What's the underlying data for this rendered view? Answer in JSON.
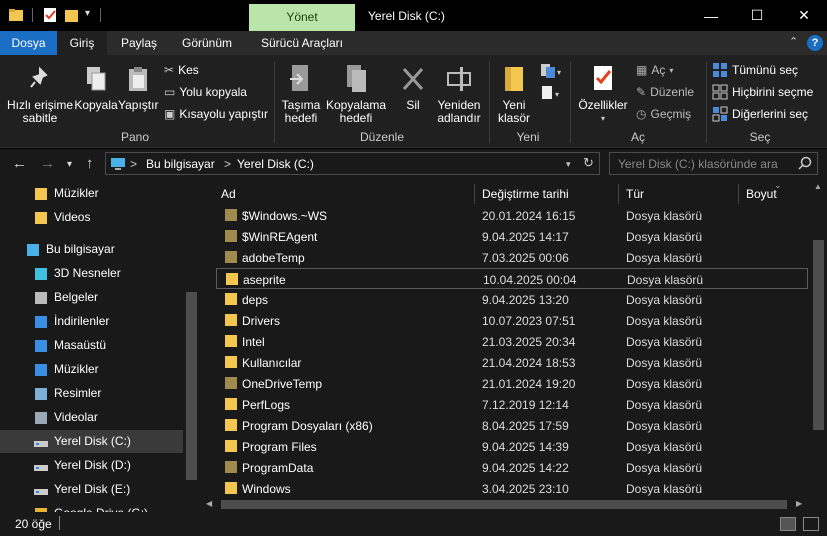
{
  "window": {
    "title": "Yerel Disk (C:)",
    "context_tab": "Yönet",
    "minimize": "—",
    "maximize": "☐",
    "close": "✕"
  },
  "ribbon_tabs": {
    "dosya": "Dosya",
    "giris": "Giriş",
    "paylas": "Paylaş",
    "gorunum": "Görünüm",
    "surucu": "Sürücü Araçları"
  },
  "ribbon": {
    "pano": {
      "label": "Pano",
      "pin": "Hızlı erişime sabitle",
      "copy": "Kopyala",
      "paste": "Yapıştır",
      "cut": "Kes",
      "copy_path": "Yolu kopyala",
      "paste_shortcut": "Kısayolu yapıştır"
    },
    "duzenle": {
      "label": "Düzenle",
      "move": "Taşıma hedefi",
      "copyto": "Kopyalama hedefi",
      "delete": "Sil",
      "rename": "Yeniden adlandır"
    },
    "yeni": {
      "label": "Yeni",
      "new_folder": "Yeni klasör"
    },
    "ac": {
      "label": "Aç",
      "properties": "Özellikler",
      "open": "Aç",
      "edit": "Düzenle",
      "history": "Geçmiş"
    },
    "sec": {
      "label": "Seç",
      "select_all": "Tümünü seç",
      "select_none": "Hiçbirini seçme",
      "invert": "Diğerlerini seç"
    }
  },
  "address": {
    "crumb1": "Bu bilgisayar",
    "crumb2": "Yerel Disk (C:)",
    "sep": ">",
    "search_placeholder": "Yerel Disk (C:) klasöründe ara"
  },
  "nav": {
    "items": [
      {
        "label": "Müzikler",
        "icon": "music-folder-icon"
      },
      {
        "label": "Videos",
        "icon": "folder-icon"
      },
      {
        "label": "Bu bilgisayar",
        "icon": "pc-icon"
      },
      {
        "label": "3D Nesneler",
        "icon": "3d-objects-icon"
      },
      {
        "label": "Belgeler",
        "icon": "documents-icon"
      },
      {
        "label": "İndirilenler",
        "icon": "downloads-icon"
      },
      {
        "label": "Masaüstü",
        "icon": "desktop-icon"
      },
      {
        "label": "Müzikler",
        "icon": "music-icon"
      },
      {
        "label": "Resimler",
        "icon": "pictures-icon"
      },
      {
        "label": "Videolar",
        "icon": "videos-icon"
      },
      {
        "label": "Yerel Disk (C:)",
        "icon": "drive-icon"
      },
      {
        "label": "Yerel Disk (D:)",
        "icon": "drive-icon"
      },
      {
        "label": "Yerel Disk (E:)",
        "icon": "drive-icon"
      },
      {
        "label": "Google Drive (G:)",
        "icon": "google-drive-icon"
      }
    ]
  },
  "columns": {
    "name": "Ad",
    "date": "Değiştirme tarihi",
    "type": "Tür",
    "size": "Boyut"
  },
  "files": [
    {
      "name": "$Windows.~WS",
      "date": "20.01.2024 16:15",
      "type": "Dosya klasörü",
      "hidden": true
    },
    {
      "name": "$WinREAgent",
      "date": "9.04.2025 14:17",
      "type": "Dosya klasörü",
      "hidden": true
    },
    {
      "name": "adobeTemp",
      "date": "7.03.2025 00:06",
      "type": "Dosya klasörü",
      "hidden": true
    },
    {
      "name": "aseprite",
      "date": "10.04.2025 00:04",
      "type": "Dosya klasörü",
      "hidden": false
    },
    {
      "name": "deps",
      "date": "9.04.2025 13:20",
      "type": "Dosya klasörü",
      "hidden": false
    },
    {
      "name": "Drivers",
      "date": "10.07.2023 07:51",
      "type": "Dosya klasörü",
      "hidden": false
    },
    {
      "name": "Intel",
      "date": "21.03.2025 20:34",
      "type": "Dosya klasörü",
      "hidden": false
    },
    {
      "name": "Kullanıcılar",
      "date": "21.04.2024 18:53",
      "type": "Dosya klasörü",
      "hidden": false
    },
    {
      "name": "OneDriveTemp",
      "date": "21.01.2024 19:20",
      "type": "Dosya klasörü",
      "hidden": true
    },
    {
      "name": "PerfLogs",
      "date": "7.12.2019 12:14",
      "type": "Dosya klasörü",
      "hidden": false
    },
    {
      "name": "Program Dosyaları (x86)",
      "date": "8.04.2025 17:59",
      "type": "Dosya klasörü",
      "hidden": false
    },
    {
      "name": "Program Files",
      "date": "9.04.2025 14:39",
      "type": "Dosya klasörü",
      "hidden": false
    },
    {
      "name": "ProgramData",
      "date": "9.04.2025 14:22",
      "type": "Dosya klasörü",
      "hidden": true
    },
    {
      "name": "Windows",
      "date": "3.04.2025 23:10",
      "type": "Dosya klasörü",
      "hidden": false
    }
  ],
  "status": {
    "count": "20 öğe"
  },
  "colors": {
    "accent": "#1a6fc4",
    "context_tab": "#b9e6a8",
    "folder": "#f3c74f",
    "folder_hidden": "#a08a4d"
  }
}
